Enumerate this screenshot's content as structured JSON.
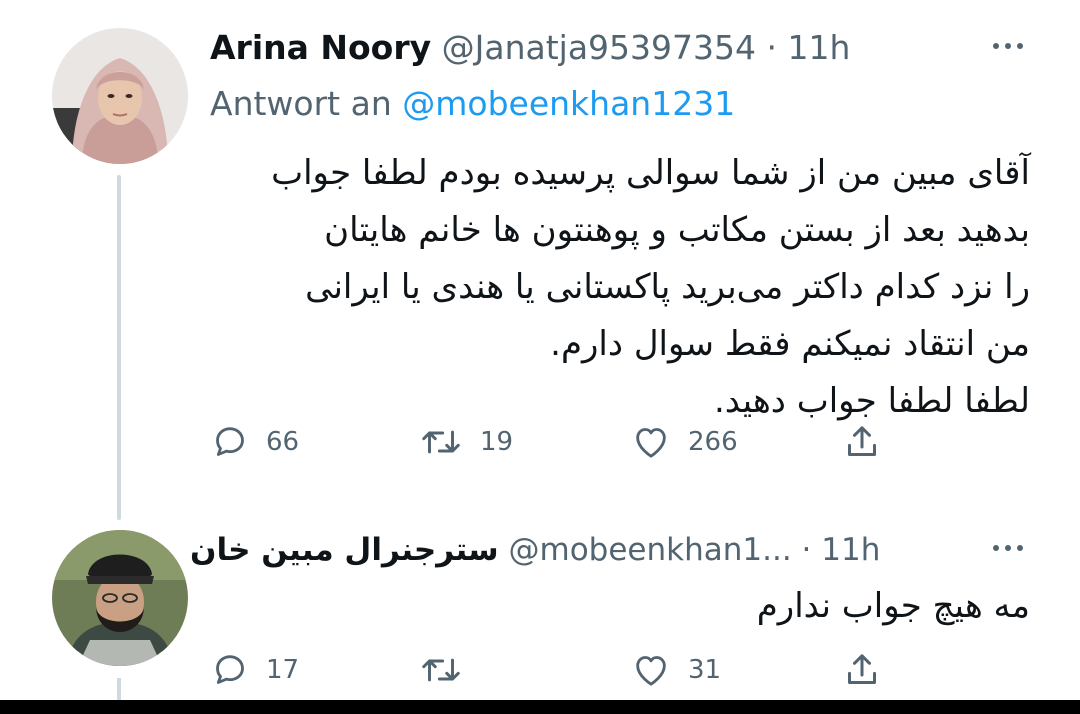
{
  "tweets": [
    {
      "display_name": "Arina Noory",
      "handle": "@Janatja95397354",
      "separator": "·",
      "time": "11h",
      "more_icon": "more-horizontal-icon",
      "reply_prefix": "Antwort an",
      "reply_handle": "@mobeenkhan1231",
      "text_lines": [
        "آقای مبین من از شما سوالی پرسیده بودم لطفا جواب",
        "بدهید بعد از بستن مکاتب و پوهنتون ها خانم هایتان",
        "را نزد کدام داکتر می‌برید پاکستانی یا هندی یا ایرانی",
        "من انتقاد نمیکنم فقط سوال دارم.",
        "لطفا لطفا جواب دهید."
      ],
      "actions": {
        "reply": {
          "icon": "reply-icon",
          "count": "66"
        },
        "retweet": {
          "icon": "retweet-icon",
          "count": "19"
        },
        "like": {
          "icon": "heart-icon",
          "count": "266"
        },
        "share": {
          "icon": "share-icon"
        }
      }
    },
    {
      "display_name": "سترجنرال مبین خان",
      "handle": "@mobeenkhan1...",
      "separator": "·",
      "time": "11h",
      "more_icon": "more-horizontal-icon",
      "text_lines": [
        "مه هیچ جواب ندارم"
      ],
      "actions": {
        "reply": {
          "icon": "reply-icon",
          "count": "17"
        },
        "retweet": {
          "icon": "retweet-icon",
          "count": ""
        },
        "like": {
          "icon": "heart-icon",
          "count": "31"
        },
        "share": {
          "icon": "share-icon"
        }
      }
    }
  ],
  "colors": {
    "text_primary": "#0f1419",
    "text_secondary": "#536471",
    "link": "#1d9bf0",
    "thread_line": "#cfd9de"
  }
}
